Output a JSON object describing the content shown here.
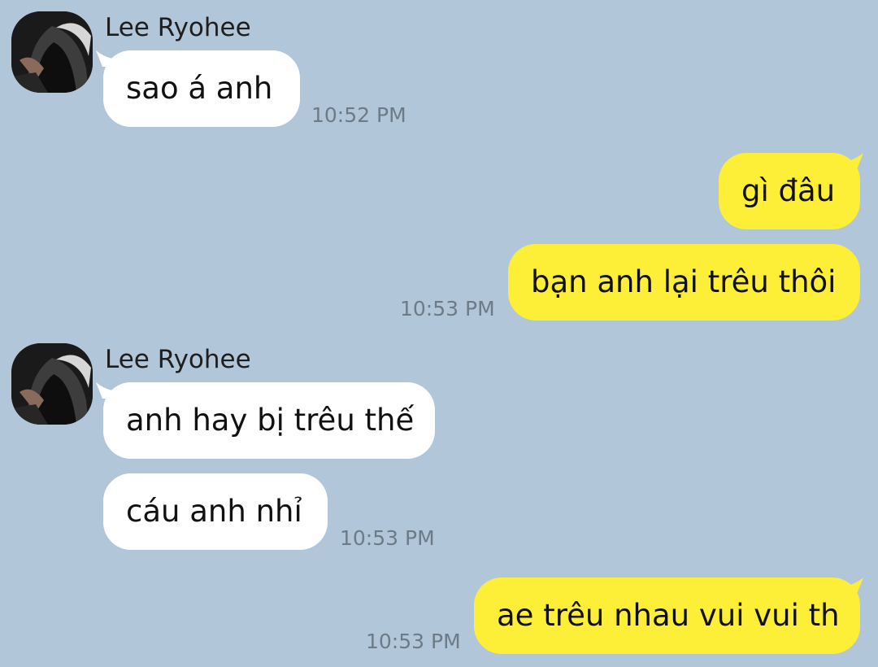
{
  "colors": {
    "background": "#b1c6d9",
    "incoming_bubble": "#ffffff",
    "outgoing_bubble": "#fdee37",
    "timestamp": "#6d7b86"
  },
  "messages": [
    {
      "sender": "Lee Ryohee",
      "text": "sao á anh",
      "time": "10:52 PM",
      "direction": "incoming"
    },
    {
      "text": "gì đâu",
      "direction": "outgoing"
    },
    {
      "text": "bạn anh lại trêu thôi",
      "time": "10:53 PM",
      "direction": "outgoing"
    },
    {
      "sender": "Lee Ryohee",
      "text": "anh hay bị trêu thế",
      "direction": "incoming"
    },
    {
      "text": "cáu anh nhỉ",
      "time": "10:53 PM",
      "direction": "incoming"
    },
    {
      "text": "ae trêu nhau vui vui th",
      "time": "10:53 PM",
      "direction": "outgoing"
    }
  ],
  "icons": {
    "avatar": "hooded-figure-avatar"
  }
}
